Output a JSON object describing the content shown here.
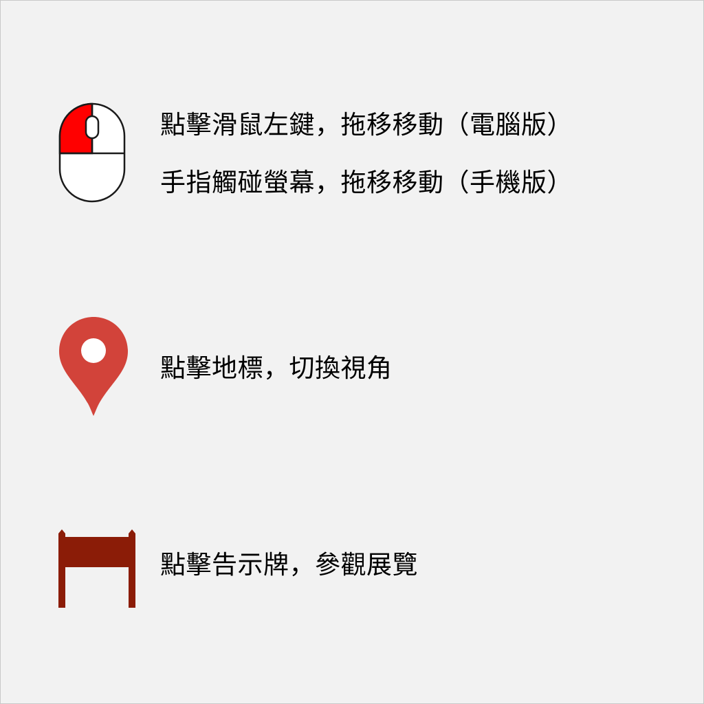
{
  "instructions": {
    "mouse": {
      "icon": "mouse-left-click-icon",
      "line1": "點擊滑鼠左鍵，拖移移動（電腦版）",
      "line2": "手指觸碰螢幕，拖移移動（手機版）"
    },
    "pin": {
      "icon": "map-pin-icon",
      "line1": "點擊地標，切換視角"
    },
    "sign": {
      "icon": "signboard-icon",
      "line1": "點擊告示牌，參觀展覽"
    }
  },
  "colors": {
    "background": "#f2f2f2",
    "mouse_button": "#ff0000",
    "pin": "#d2433a",
    "sign": "#8b1c07"
  }
}
